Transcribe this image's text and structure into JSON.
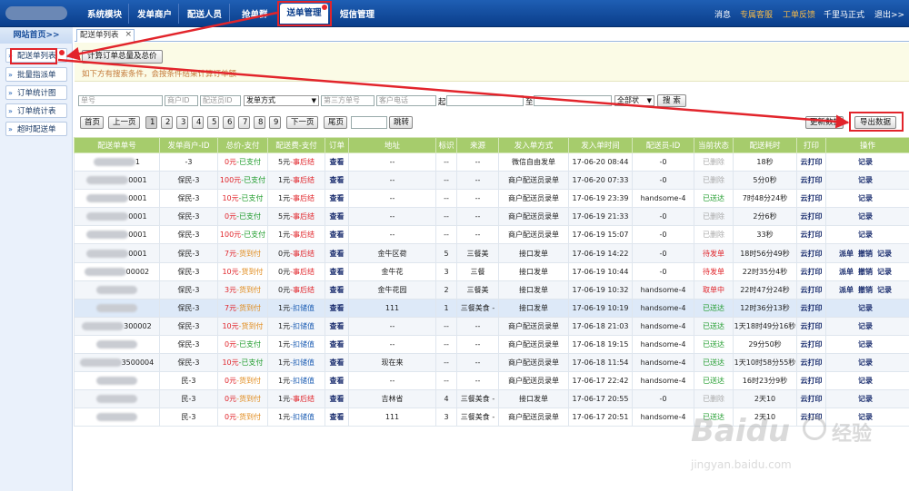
{
  "nav": {
    "items": [
      "系统模块",
      "发单商户",
      "配送人员",
      "抢单群",
      "送单管理",
      "短信管理"
    ],
    "active": "送单管理",
    "right_links": [
      "消息",
      "专属客服",
      "工单反馈",
      "千里马正式",
      "退出>>"
    ]
  },
  "sidebar": {
    "home": "网站首页>>",
    "items": [
      "配送单列表",
      "批量指派单",
      "订单统计图",
      "订单统计表",
      "超时配送单"
    ]
  },
  "tab": {
    "label": "配送单列表",
    "close": "×"
  },
  "info": {
    "calc_button": "计算订单总量及总价",
    "hint": "如下方有搜索条件，会按条件结果计算订单额"
  },
  "filters": {
    "order_no": "单号",
    "merchant_id": "商户ID",
    "courier_id": "配送员ID",
    "send_method": "发单方式",
    "third_party_no": "第三方单号",
    "customer_phone": "客户电话",
    "from_label": "起",
    "to_label": "至",
    "status": "全部状",
    "search_button": "搜 索"
  },
  "pager": {
    "first": "首页",
    "prev": "上一页",
    "pages": [
      "1",
      "2",
      "3",
      "4",
      "5",
      "6",
      "7",
      "8",
      "9"
    ],
    "current": "1",
    "next": "下一页",
    "last": "尾页",
    "jump": "跳转"
  },
  "toolbar": {
    "refresh": "更新数据",
    "export": "导出数据"
  },
  "table": {
    "headers": [
      "配送单单号",
      "发单商户-ID",
      "总价-支付",
      "配送费-支付",
      "订单",
      "地址",
      "标识",
      "来源",
      "发入单方式",
      "发入单时间",
      "配送员-ID",
      "当前状态",
      "配送耗时",
      "打印",
      "操作"
    ],
    "rows": [
      {
        "no": "1",
        "merchant": "-3",
        "price": "0元",
        "pay": "-已支付",
        "fee": "5元",
        "fee_pay": "-事后结",
        "order": "查看",
        "addr": "--",
        "flag": "--",
        "src": "--",
        "method": "微信自由发单",
        "time": "17-06-20 08:44",
        "courier": "-0",
        "status": "已删除",
        "dur": "18秒",
        "print": "云打印",
        "ops": [
          "记录"
        ]
      },
      {
        "no": "0001",
        "merchant": "保民-3",
        "price": "100元",
        "pay": "-已支付",
        "fee": "1元",
        "fee_pay": "-事后结",
        "order": "查看",
        "addr": "--",
        "flag": "--",
        "src": "--",
        "method": "商户配送员录单",
        "time": "17-06-20 07:33",
        "courier": "-0",
        "status": "已删除",
        "dur": "5分0秒",
        "print": "云打印",
        "ops": [
          "记录"
        ]
      },
      {
        "no": "0001",
        "merchant": "保民-3",
        "price": "10元",
        "pay": "-已支付",
        "fee": "1元",
        "fee_pay": "-事后结",
        "order": "查看",
        "addr": "--",
        "flag": "--",
        "src": "--",
        "method": "商户配送员录单",
        "time": "17-06-19 23:39",
        "courier": "handsome-4",
        "status": "已送达",
        "dur": "7时48分24秒",
        "print": "云打印",
        "ops": [
          "记录"
        ]
      },
      {
        "no": "0001",
        "merchant": "保民-3",
        "price": "0元",
        "pay": "-已支付",
        "fee": "5元",
        "fee_pay": "-事后结",
        "order": "查看",
        "addr": "--",
        "flag": "--",
        "src": "--",
        "method": "商户配送员录单",
        "time": "17-06-19 21:33",
        "courier": "-0",
        "status": "已删除",
        "dur": "2分6秒",
        "print": "云打印",
        "ops": [
          "记录"
        ]
      },
      {
        "no": "0001",
        "merchant": "保民-3",
        "price": "100元",
        "pay": "-已支付",
        "fee": "1元",
        "fee_pay": "-事后结",
        "order": "查看",
        "addr": "--",
        "flag": "--",
        "src": "--",
        "method": "商户配送员录单",
        "time": "17-06-19 15:07",
        "courier": "-0",
        "status": "已删除",
        "dur": "33秒",
        "print": "云打印",
        "ops": [
          "记录"
        ]
      },
      {
        "no": "0001",
        "merchant": "保民-3",
        "price": "7元",
        "pay": "-货到付",
        "fee": "0元",
        "fee_pay": "-事后结",
        "order": "查看",
        "addr": "金牛区荷",
        "flag": "5",
        "src": "三餐美",
        "method": "接口发单",
        "time": "17-06-19 14:22",
        "courier": "-0",
        "status": "待发单",
        "dur": "18时56分49秒",
        "print": "云打印",
        "ops": [
          "派单",
          "撤销",
          "记录"
        ]
      },
      {
        "no": "00002",
        "merchant": "保民-3",
        "price": "10元",
        "pay": "-货到付",
        "fee": "0元",
        "fee_pay": "-事后结",
        "order": "查看",
        "addr": "金牛花",
        "flag": "3",
        "src": "三餐",
        "method": "接口发单",
        "time": "17-06-19 10:44",
        "courier": "-0",
        "status": "待发单",
        "dur": "22时35分4秒",
        "print": "云打印",
        "ops": [
          "派单",
          "撤销",
          "记录"
        ]
      },
      {
        "no": "",
        "merchant": "保民-3",
        "price": "3元",
        "pay": "-货到付",
        "fee": "0元",
        "fee_pay": "-事后结",
        "order": "查看",
        "addr": "金牛花园",
        "flag": "2",
        "src": "三餐美",
        "method": "接口发单",
        "time": "17-06-19 10:32",
        "courier": "handsome-4",
        "status": "取单中",
        "dur": "22时47分24秒",
        "print": "云打印",
        "ops": [
          "派单",
          "撤销",
          "记录"
        ]
      },
      {
        "no": "",
        "merchant": "保民-3",
        "price": "7元",
        "pay": "-货到付",
        "fee": "1元",
        "fee_pay": "-扣储值",
        "order": "查看",
        "addr": "111",
        "flag": "1",
        "src": "三餐美食 -",
        "method": "接口发单",
        "time": "17-06-19 10:19",
        "courier": "handsome-4",
        "status": "已送达",
        "dur": "12时36分13秒",
        "print": "云打印",
        "ops": [
          "记录"
        ]
      },
      {
        "no": "300002",
        "merchant": "保民-3",
        "price": "10元",
        "pay": "-货到付",
        "fee": "1元",
        "fee_pay": "-扣储值",
        "order": "查看",
        "addr": "--",
        "flag": "--",
        "src": "--",
        "method": "商户配送员录单",
        "time": "17-06-18 21:03",
        "courier": "handsome-4",
        "status": "已送达",
        "dur": "1天18时49分16秒",
        "print": "云打印",
        "ops": [
          "记录"
        ]
      },
      {
        "no": "",
        "merchant": "保民-3",
        "price": "0元",
        "pay": "-已支付",
        "fee": "1元",
        "fee_pay": "-扣储值",
        "order": "查看",
        "addr": "--",
        "flag": "--",
        "src": "--",
        "method": "商户配送员录单",
        "time": "17-06-18 19:15",
        "courier": "handsome-4",
        "status": "已送达",
        "dur": "29分50秒",
        "print": "云打印",
        "ops": [
          "记录"
        ]
      },
      {
        "no": "3500004",
        "merchant": "保民-3",
        "price": "10元",
        "pay": "-已支付",
        "fee": "1元",
        "fee_pay": "-扣储值",
        "order": "查看",
        "addr": "现在来",
        "flag": "--",
        "src": "--",
        "method": "商户配送员录单",
        "time": "17-06-18 11:54",
        "courier": "handsome-4",
        "status": "已送达",
        "dur": "1天10时58分55秒",
        "print": "云打印",
        "ops": [
          "记录"
        ]
      },
      {
        "no": "",
        "merchant": "民-3",
        "price": "0元",
        "pay": "-货到付",
        "fee": "1元",
        "fee_pay": "-扣储值",
        "order": "查看",
        "addr": "--",
        "flag": "--",
        "src": "--",
        "method": "商户配送员录单",
        "time": "17-06-17 22:42",
        "courier": "handsome-4",
        "status": "已送达",
        "dur": "16时23分9秒",
        "print": "云打印",
        "ops": [
          "记录"
        ]
      },
      {
        "no": "",
        "merchant": "民-3",
        "price": "0元",
        "pay": "-货到付",
        "fee": "1元",
        "fee_pay": "-事后结",
        "order": "查看",
        "addr": "吉林省",
        "flag": "4",
        "src": "三餐美食 -",
        "method": "接口发单",
        "time": "17-06-17 20:55",
        "courier": "-0",
        "status": "已删除",
        "dur": "2天10",
        "print": "云打印",
        "ops": [
          "记录"
        ]
      },
      {
        "no": "",
        "merchant": "民-3",
        "price": "0元",
        "pay": "-货到付",
        "fee": "1元",
        "fee_pay": "-扣储值",
        "order": "查看",
        "addr": "111",
        "flag": "3",
        "src": "三餐美食 -",
        "method": "商户配送员录单",
        "time": "17-06-17 20:51",
        "courier": "handsome-4",
        "status": "已送达",
        "dur": "2天10",
        "print": "云打印",
        "ops": [
          "记录"
        ]
      }
    ]
  },
  "watermark": {
    "text1": "Baidu",
    "text2": "经验",
    "url": "jingyan.baidu.com"
  },
  "colors": {
    "accent": "#1f5fb4",
    "header_green": "#a6cc6c",
    "red": "#e0242a",
    "green": "#1e9b2b",
    "orange": "#e08a1a"
  }
}
